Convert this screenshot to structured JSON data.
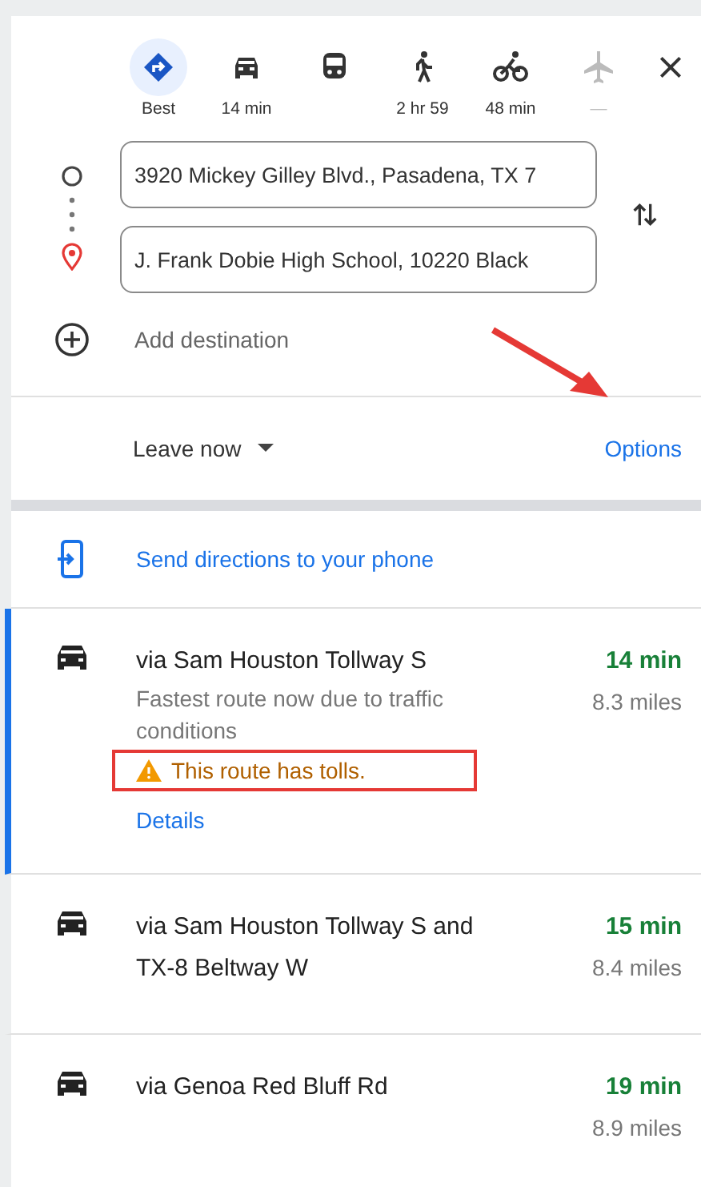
{
  "modes": [
    {
      "kind": "best",
      "label": "Best",
      "selected": true,
      "disabled": false
    },
    {
      "kind": "car",
      "label": "14 min",
      "selected": false,
      "disabled": false
    },
    {
      "kind": "transit",
      "selected": false,
      "disabled": false
    },
    {
      "kind": "walk",
      "label": "2 hr 59",
      "selected": false,
      "disabled": false
    },
    {
      "kind": "bike",
      "label": "48 min",
      "selected": false,
      "disabled": false
    },
    {
      "kind": "plane",
      "label": "—",
      "selected": false,
      "disabled": true
    }
  ],
  "stops": [
    {
      "kind": "origin",
      "value": "3920 Mickey Gilley Blvd., Pasadena, TX 7"
    },
    {
      "kind": "destination",
      "value": "J. Frank Dobie High School, 10220 Black"
    }
  ],
  "add_destination": "Add destination",
  "departure": {
    "label": "Leave now"
  },
  "options_link": "Options",
  "send_to_phone": "Send directions to your phone",
  "routes": [
    {
      "title": "via Sam Houston Tollway S",
      "description": "Fastest route now due to traffic conditions",
      "warning": "This route has tolls.",
      "details_link": "Details",
      "time": "14 min",
      "distance": "8.3 miles",
      "selected": true
    },
    {
      "title": "via Sam Houston Tollway S and TX-8 Beltway W",
      "time": "15 min",
      "distance": "8.4 miles",
      "selected": false
    },
    {
      "title": "via Genoa Red Bluff Rd",
      "time": "19 min",
      "distance": "8.9 miles",
      "selected": false
    }
  ]
}
